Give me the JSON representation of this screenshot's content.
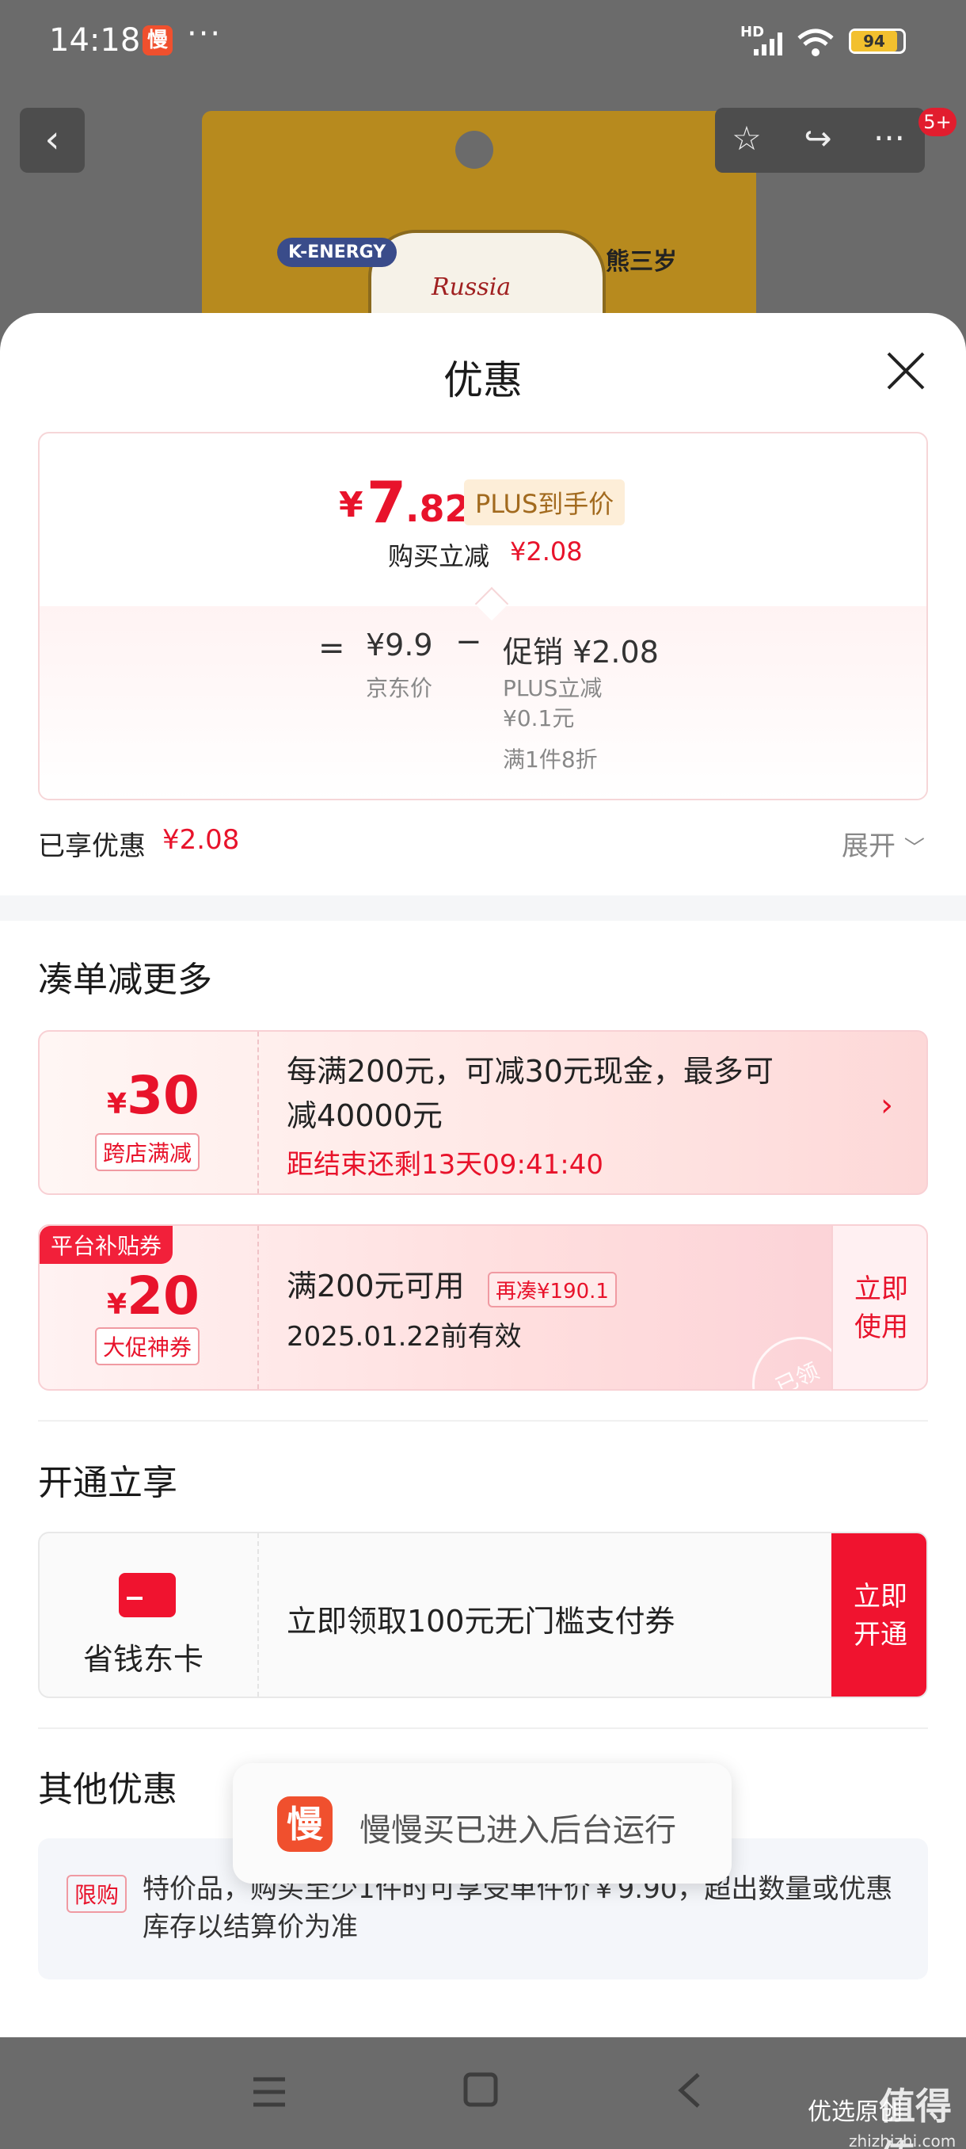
{
  "status_bar": {
    "time": "14:18",
    "app_badge": "慢",
    "more": "···",
    "network": "HD",
    "battery": "94"
  },
  "product_header": {
    "brand_label": "K-ENERGY",
    "label_text": "Russia",
    "maker_text": "熊三岁",
    "notification_count": "5+"
  },
  "sheet": {
    "title": "优惠",
    "price_card": {
      "currency": "¥",
      "price_integer": "7",
      "price_decimal": ".82",
      "plus_tag": "PLUS到手价",
      "buy_label": "购买立减",
      "buy_amount": "¥2.08",
      "equals": "=",
      "jd_price": "¥9.9",
      "jd_label": "京东价",
      "minus": "−",
      "promo_label": "促销 ¥2.08",
      "promo_sub1": "PLUS立减",
      "promo_sub2": "¥0.1元",
      "promo_sub3": "满1件8折"
    },
    "enjoyed_label": "已享优惠",
    "enjoyed_amount": "¥2.08",
    "expand_label": "展开"
  },
  "section_more": {
    "title": "凑单减更多",
    "coupon1": {
      "currency": "¥",
      "amount": "30",
      "tag": "跨店满减",
      "line1": "每满200元，可减30元现金，最多可",
      "line2": "减40000元",
      "countdown": "距结束还剩13天09:41:40"
    },
    "coupon2": {
      "corner_tag": "平台补贴券",
      "currency": "¥",
      "amount": "20",
      "tag": "大促神券",
      "condition": "满200元可用",
      "reuse_tag": "再凑¥190.1",
      "validity": "2025.01.22前有效",
      "button_line1": "立即",
      "button_line2": "使用",
      "stamp": "已领"
    }
  },
  "section_open": {
    "title": "开通立享",
    "card_label": "省钱东卡",
    "text": "立即领取100元无门槛支付券",
    "button_line1": "立即",
    "button_line2": "开通"
  },
  "section_other": {
    "title": "其他优惠",
    "limit_tag": "限购",
    "text": "特价品，购买至少1件时可享受单件价￥9.90，超出数量或优惠库存以结算价为准"
  },
  "toast": {
    "icon": "慢",
    "text": "慢慢买已进入后台运行"
  },
  "watermark": {
    "left": "优选原创",
    "big": "值得值",
    "site": "zhizhizhi.com"
  },
  "colors": {
    "accent_red": "#e8132b",
    "button_red": "#f0132f",
    "plus_gold": "#a26a1e"
  }
}
